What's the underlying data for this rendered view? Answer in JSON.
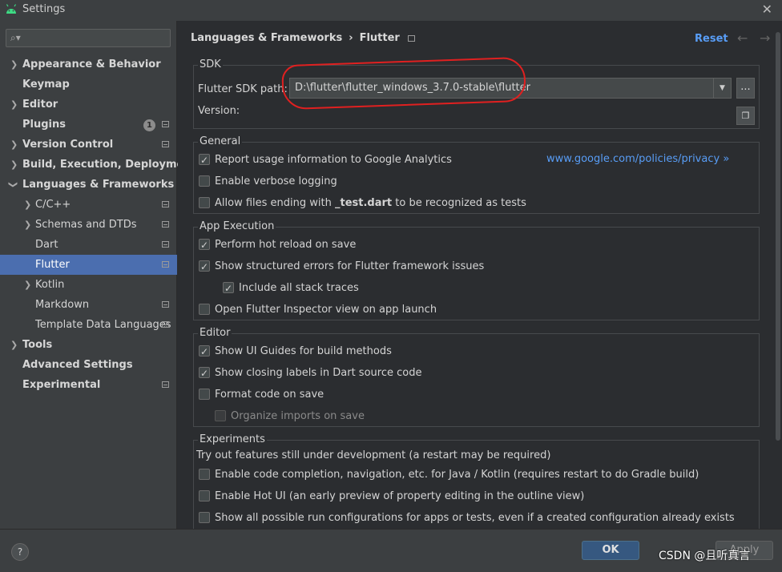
{
  "window": {
    "title": "Settings"
  },
  "sidebar": {
    "search_placeholder": "",
    "items": [
      {
        "label": "Appearance & Behavior"
      },
      {
        "label": "Keymap"
      },
      {
        "label": "Editor"
      },
      {
        "label": "Plugins",
        "badge": "1"
      },
      {
        "label": "Version Control"
      },
      {
        "label": "Build, Execution, Deployment"
      },
      {
        "label": "Languages & Frameworks"
      },
      {
        "label": "C/C++"
      },
      {
        "label": "Schemas and DTDs"
      },
      {
        "label": "Dart"
      },
      {
        "label": "Flutter"
      },
      {
        "label": "Kotlin"
      },
      {
        "label": "Markdown"
      },
      {
        "label": "Template Data Languages"
      },
      {
        "label": "Tools"
      },
      {
        "label": "Advanced Settings"
      },
      {
        "label": "Experimental"
      }
    ]
  },
  "header": {
    "breadcrumb_parent": "Languages & Frameworks",
    "breadcrumb_current": "Flutter",
    "breadcrumb_sep": "›",
    "reset": "Reset"
  },
  "sdk": {
    "title": "SDK",
    "path_label": "Flutter SDK path:",
    "path_value": "D:\\flutter\\flutter_windows_3.7.0-stable\\flutter",
    "browse": "...",
    "version_label": "Version:"
  },
  "general": {
    "title": "General",
    "analytics": "Report usage information to Google Analytics",
    "privacy_link": "www.google.com/policies/privacy",
    "privacy_arrow": "»",
    "verbose": "Enable verbose logging",
    "test_pre": "Allow files ending with ",
    "test_bold": "_test.dart",
    "test_post": " to be recognized as tests"
  },
  "app_execution": {
    "title": "App Execution",
    "hot_reload": "Perform hot reload on save",
    "structured_errors": "Show structured errors for Flutter framework issues",
    "stack_traces": "Include all stack traces",
    "inspector": "Open Flutter Inspector view on app launch"
  },
  "editor": {
    "title": "Editor",
    "ui_guides": "Show UI Guides for build methods",
    "closing_labels": "Show closing labels in Dart source code",
    "format_on_save": "Format code on save",
    "organize_imports": "Organize imports on save"
  },
  "experiments": {
    "title": "Experiments",
    "desc": "Try out features still under development (a restart may be required)",
    "code_completion": "Enable code completion, navigation, etc. for Java / Kotlin (requires restart to do Gradle build)",
    "hot_ui": "Enable Hot UI (an early preview of property editing in the outline view)",
    "run_configs": "Show all possible run configurations for apps or tests, even if a created configuration already exists"
  },
  "footer": {
    "help": "?",
    "ok": "OK",
    "apply": "Apply"
  },
  "watermark": "CSDN @且听真言",
  "colors": {
    "accent": "#4b6eaf",
    "link": "#589df6",
    "annotation": "#e02020"
  }
}
